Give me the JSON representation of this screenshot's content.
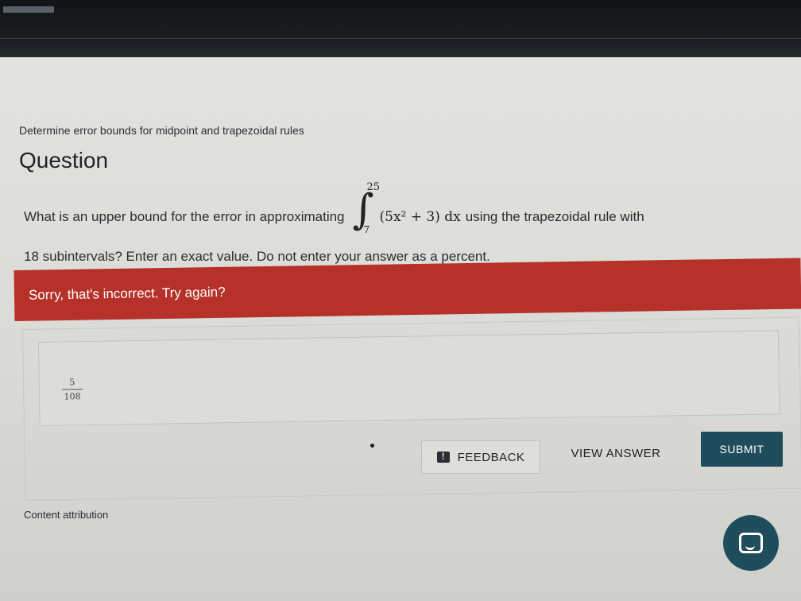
{
  "assignment": {
    "breadcrumb": "Determine error bounds for midpoint and trapezoidal rules",
    "title": "Question"
  },
  "question": {
    "text_before": "What is an upper bound for the error in approximating",
    "integral_upper": "25",
    "integral_lower": "7",
    "integrand": "(5x² + 3) dx",
    "text_after": "using the trapezoidal rule with",
    "line2": "18 subintervals? Enter an exact value. Do not enter your answer as a percent."
  },
  "feedback_banner": {
    "message": "Sorry, that's incorrect. Try again?",
    "color": "#b6312a"
  },
  "answer": {
    "numerator": "5",
    "denominator": "108"
  },
  "actions": {
    "feedback_label": "FEEDBACK",
    "feedback_icon": "feedback-icon",
    "view_answer_label": "VIEW ANSWER",
    "submit_label": "SUBMIT",
    "submit_color": "#1f4d5b"
  },
  "footer": {
    "attribution": "Content attribution",
    "chat_icon": "chat-icon"
  }
}
